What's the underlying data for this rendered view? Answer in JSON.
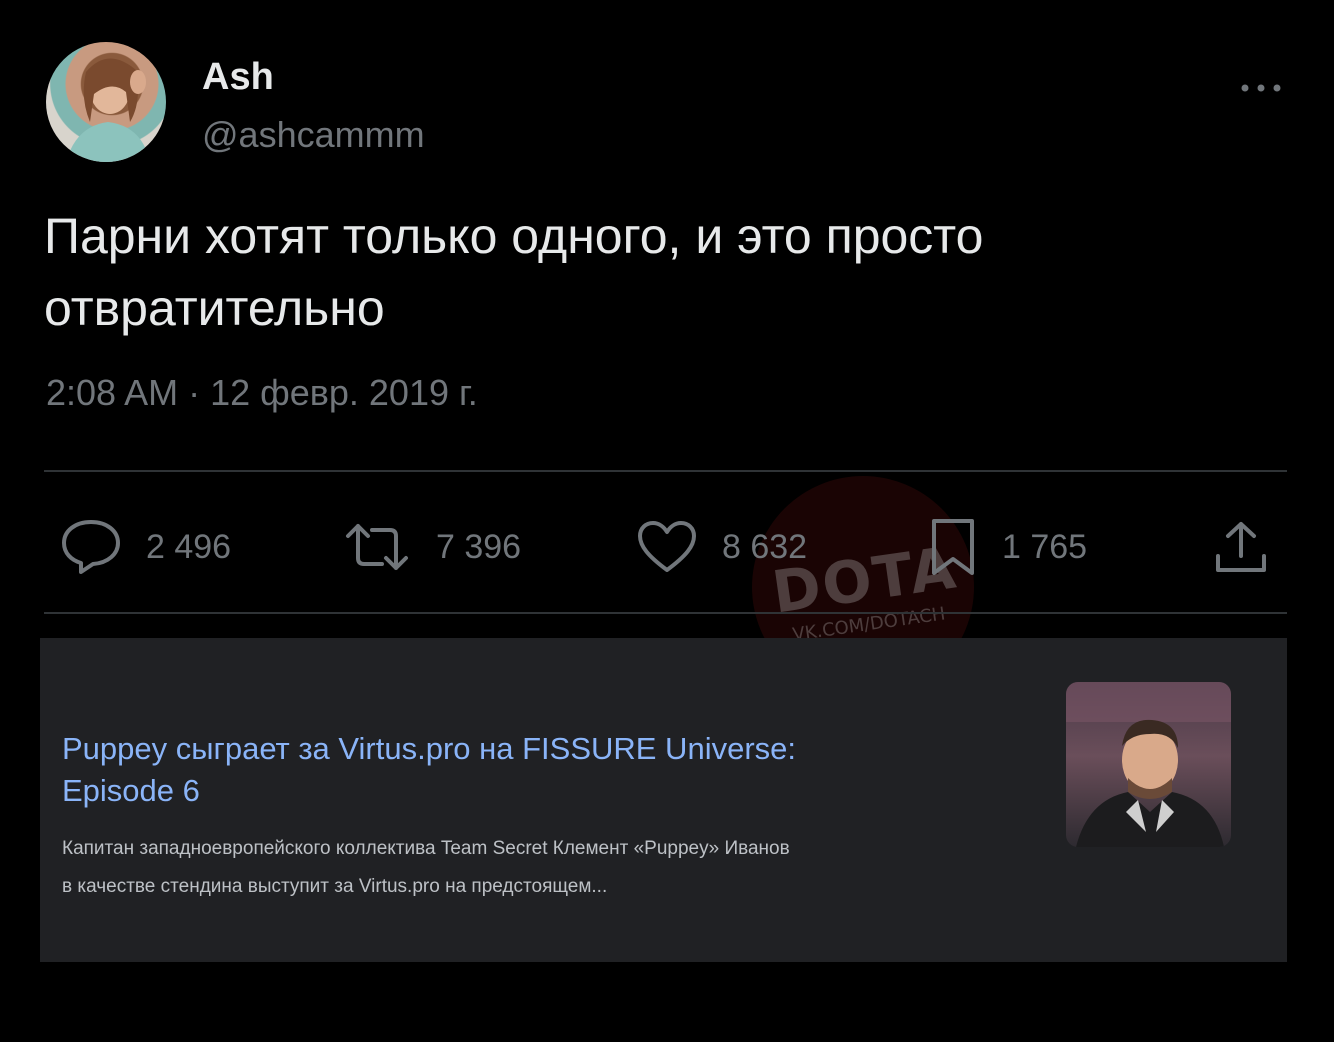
{
  "author": {
    "name": "Ash",
    "handle": "@ashcammm",
    "avatar_icon": "profile-photo"
  },
  "tweet": {
    "text_line1": "Парни хотят только одного, и это просто",
    "text_line2": "отвратительно",
    "timestamp": "2:08 AM · 12 февр. 2019 г."
  },
  "actions": {
    "reply_count": "2 496",
    "retweet_count": "7 396",
    "like_count": "8 632",
    "bookmark_count": "1 765"
  },
  "watermark": {
    "main": "DOTA",
    "sub": "VK.COM/DOTACH"
  },
  "card": {
    "title_line1": "Puppey сыграет за Virtus.pro на FISSURE Universe:",
    "title_line2": "Episode 6",
    "snippet_line1": "Капитан западноевропейского коллектива Team Secret Клемент «Puppey» Иванов",
    "snippet_line2": "в качестве стендина выступит за Virtus.pro на предстоящем..."
  },
  "colors": {
    "background": "#000000",
    "text": "#e7e9ea",
    "muted": "#71767b",
    "link": "#8ab4f8",
    "card_bg": "#202124"
  }
}
